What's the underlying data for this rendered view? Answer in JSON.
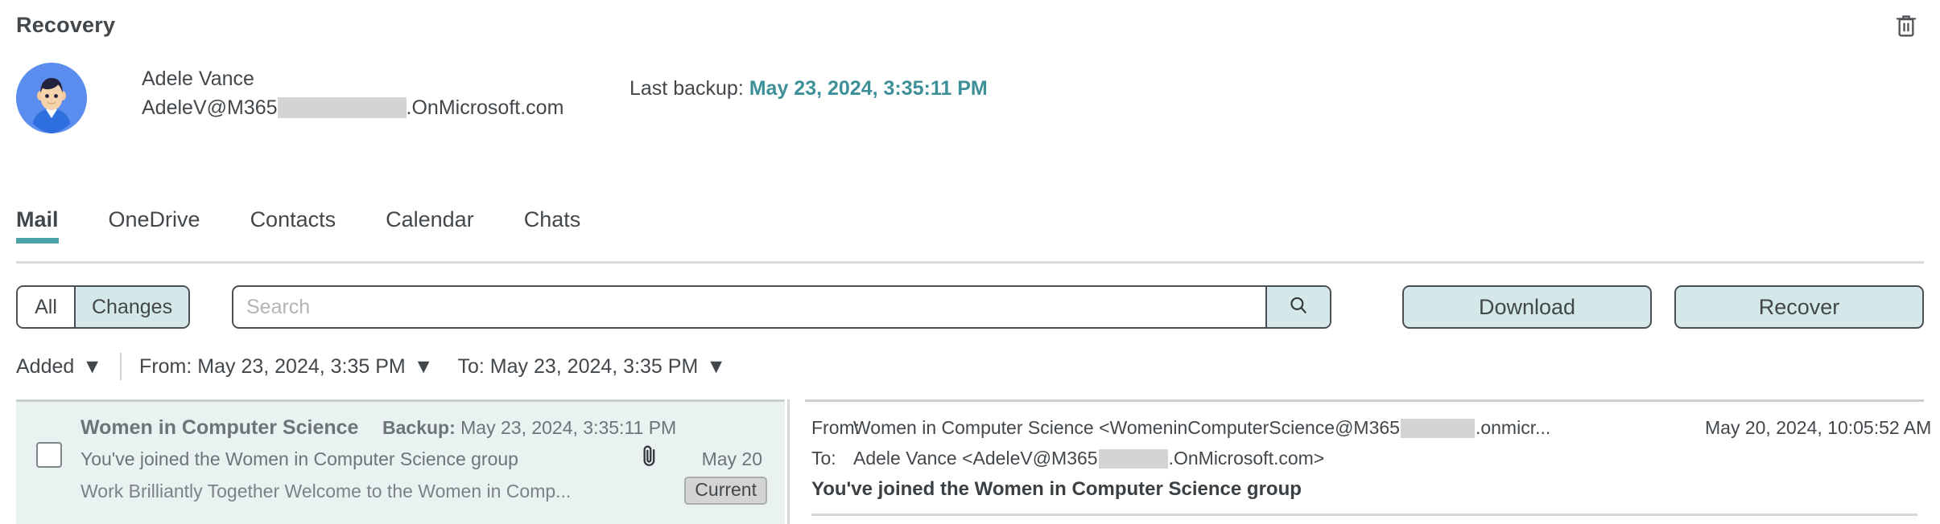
{
  "header": {
    "title": "Recovery",
    "delete_icon": "trash-icon"
  },
  "identity": {
    "avatar_icon": "user-avatar",
    "name": "Adele Vance",
    "email_prefix": "AdeleV@M365",
    "email_suffix": ".OnMicrosoft.com",
    "last_backup_label": "Last backup:",
    "last_backup_value": "May 23, 2024, 3:35:11 PM"
  },
  "tabs": [
    {
      "label": "Mail",
      "active": true
    },
    {
      "label": "OneDrive",
      "active": false
    },
    {
      "label": "Contacts",
      "active": false
    },
    {
      "label": "Calendar",
      "active": false
    },
    {
      "label": "Chats",
      "active": false
    }
  ],
  "toolbar": {
    "segment": {
      "all_label": "All",
      "changes_label": "Changes",
      "selected": "Changes"
    },
    "search": {
      "value": "",
      "placeholder": "Search",
      "button_icon": "search-icon"
    },
    "download_label": "Download",
    "recover_label": "Recover"
  },
  "filters": {
    "added_label": "Added",
    "from_label": "From: May 23, 2024, 3:35 PM",
    "to_label": "To: May 23, 2024, 3:35 PM",
    "caret": "▼"
  },
  "list": {
    "rows": [
      {
        "checked": false,
        "sender": "Women in Computer Science",
        "backup_label": "Backup:",
        "backup_value": "May 23, 2024, 3:35:11 PM",
        "subject": "You've joined the Women in Computer Science group",
        "attachment_icon": "paperclip-icon",
        "date": "May 20",
        "badge": "Current",
        "preview": "Work Brilliantly Together Welcome to the Women in Comp..."
      }
    ]
  },
  "detail": {
    "from_label": "From:",
    "from_value_prefix": "Women in Computer Science <WomeninComputerScience@M365",
    "from_value_suffix": ".onmicr...",
    "from_date": "May 20, 2024, 10:05:52 AM",
    "to_label": "To:",
    "to_value_prefix": "Adele Vance <AdeleV@M365",
    "to_value_suffix": ".OnMicrosoft.com>",
    "subject": "You've joined the Women in Computer Science group"
  },
  "colors": {
    "accent_teal": "#4ba3a8",
    "link_teal": "#3d9098",
    "button_fill": "#d4e7e9",
    "row_fill": "#e9f1f1",
    "avatar_blue": "#5b8def"
  }
}
